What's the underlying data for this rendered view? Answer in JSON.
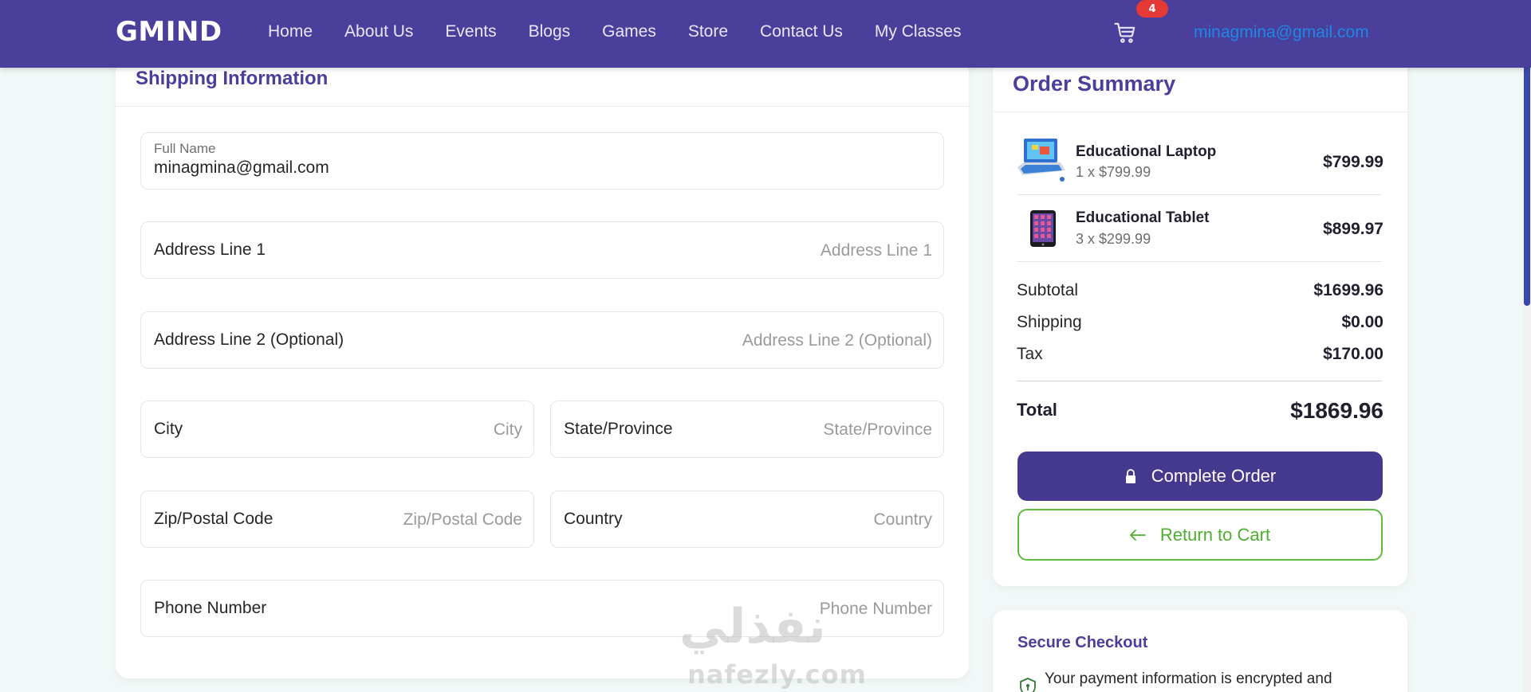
{
  "nav": {
    "brand": "GMIND",
    "links": [
      "Home",
      "About Us",
      "Events",
      "Blogs",
      "Games",
      "Store",
      "Contact Us",
      "My Classes"
    ],
    "cart_count": "4",
    "user_email": "minagmina@gmail.com"
  },
  "shipping": {
    "title": "Shipping Information",
    "full_name": {
      "label": "Full Name",
      "value": "minagmina@gmail.com"
    },
    "address1": {
      "label": "Address Line 1",
      "placeholder": "Address Line 1"
    },
    "address2": {
      "label": "Address Line 2 (Optional)",
      "placeholder": "Address Line 2 (Optional)"
    },
    "city": {
      "label": "City",
      "placeholder": "City"
    },
    "state": {
      "label": "State/Province",
      "placeholder": "State/Province"
    },
    "zip": {
      "label": "Zip/Postal Code",
      "placeholder": "Zip/Postal Code"
    },
    "country": {
      "label": "Country",
      "placeholder": "Country"
    },
    "phone": {
      "label": "Phone Number",
      "placeholder": "Phone Number"
    }
  },
  "summary": {
    "title": "Order Summary",
    "items": [
      {
        "name": "Educational Laptop",
        "qty": "1 x $799.99",
        "price": "$799.99"
      },
      {
        "name": "Educational Tablet",
        "qty": "3 x $299.99",
        "price": "$899.97"
      }
    ],
    "subtotal_label": "Subtotal",
    "subtotal": "$1699.96",
    "shipping_label": "Shipping",
    "shipping": "$0.00",
    "tax_label": "Tax",
    "tax": "$170.00",
    "total_label": "Total",
    "total": "$1869.96",
    "complete_label": "Complete Order",
    "return_label": "Return to Cart"
  },
  "secure": {
    "title": "Secure Checkout",
    "text": "Your payment information is encrypted and"
  },
  "watermark": {
    "arabic": "نفذلي",
    "latin": "nafezly.com"
  },
  "colors": {
    "nav_bg": "#4a3f9a",
    "accent": "#44398f",
    "return_green": "#4caf2e",
    "link_blue": "#1e88e5",
    "badge_red": "#e53935"
  }
}
